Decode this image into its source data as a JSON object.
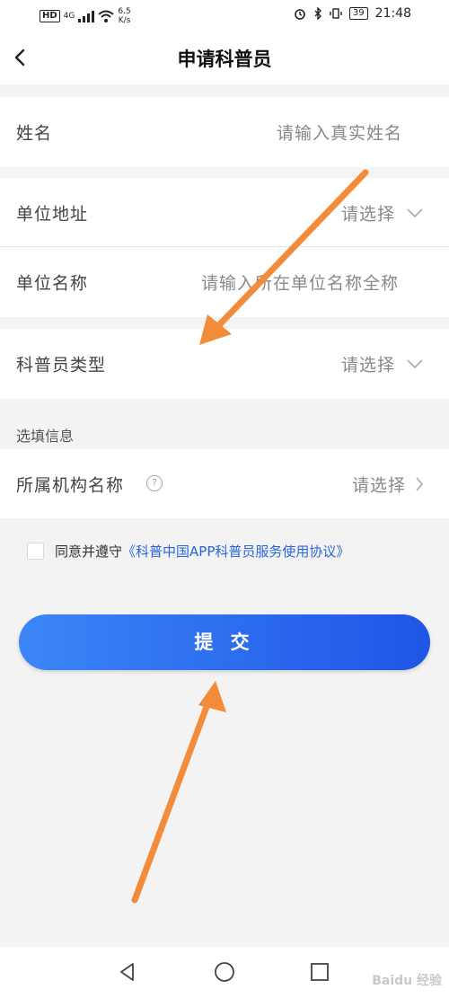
{
  "status_bar": {
    "left_badge": "HD",
    "network": "4G",
    "speed": "6.5",
    "speed_unit": "K/s",
    "battery": "39",
    "time": "21:48"
  },
  "header": {
    "title": "申请科普员"
  },
  "form": {
    "name": {
      "label": "姓名",
      "placeholder": "请输入真实姓名"
    },
    "unit_address": {
      "label": "单位地址",
      "value": "请选择"
    },
    "unit_name": {
      "label": "单位名称",
      "placeholder": "请输入所在单位名称全称"
    },
    "type": {
      "label": "科普员类型",
      "value": "请选择"
    },
    "optional_section": "选填信息",
    "org_name": {
      "label": "所属机构名称",
      "help": "?",
      "value": "请选择"
    }
  },
  "agreement": {
    "prefix": "同意并遵守",
    "link": "《科普中国APP科普员服务使用协议》"
  },
  "submit_label": "提 交",
  "watermark": "Baidu 经验",
  "icons": [
    "back-icon",
    "chevron-down-icon",
    "chevron-right-icon",
    "help-icon",
    "nav-back-icon",
    "nav-home-icon",
    "nav-recents-icon"
  ],
  "colors": {
    "accent": "#1f55e6",
    "link": "#2a66d8",
    "annotation_arrow": "#f28c3a"
  }
}
